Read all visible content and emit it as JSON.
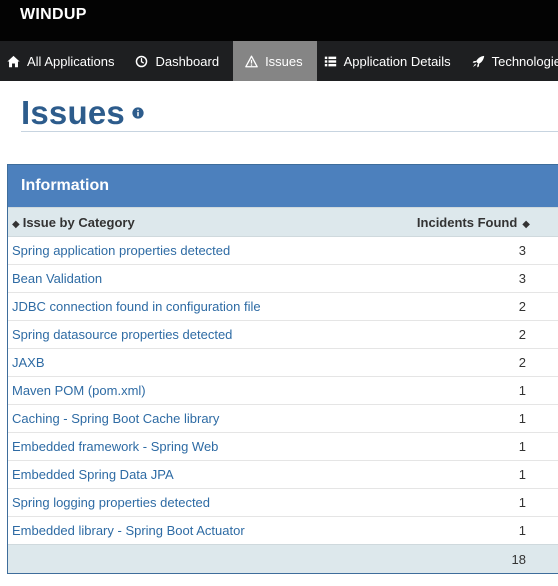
{
  "app": {
    "brand": "WINDUP"
  },
  "nav": [
    {
      "label": "All Applications",
      "icon": "home-icon",
      "active": false
    },
    {
      "label": "Dashboard",
      "icon": "clock-icon",
      "active": false
    },
    {
      "label": "Issues",
      "icon": "warning-icon",
      "active": true
    },
    {
      "label": "Application Details",
      "icon": "list-icon",
      "active": false
    },
    {
      "label": "Technologies",
      "icon": "rocket-icon",
      "active": false
    }
  ],
  "page": {
    "title": "Issues",
    "info_icon": "info-icon"
  },
  "panel": {
    "title": "Information",
    "columns": {
      "category": "Issue by Category",
      "incidents": "Incidents Found"
    },
    "rows": [
      {
        "category": "Spring application properties detected",
        "incidents": "3"
      },
      {
        "category": "Bean Validation",
        "incidents": "3"
      },
      {
        "category": "JDBC connection found in configuration file",
        "incidents": "2"
      },
      {
        "category": "Spring datasource properties detected",
        "incidents": "2"
      },
      {
        "category": "JAXB",
        "incidents": "2"
      },
      {
        "category": "Maven POM (pom.xml)",
        "incidents": "1"
      },
      {
        "category": "Caching - Spring Boot Cache library",
        "incidents": "1"
      },
      {
        "category": "Embedded framework - Spring Web",
        "incidents": "1"
      },
      {
        "category": "Embedded Spring Data JPA",
        "incidents": "1"
      },
      {
        "category": "Spring logging properties detected",
        "incidents": "1"
      },
      {
        "category": "Embedded library - Spring Boot Actuator",
        "incidents": "1"
      }
    ],
    "total": "18"
  },
  "colors": {
    "brand_bar": "#030303",
    "nav_bar": "#1e1f21",
    "nav_active": "#858585",
    "title": "#2d5c8c",
    "panel_heading": "#4c80bd",
    "table_header": "#dde8ec",
    "link": "#2e6ba4"
  }
}
